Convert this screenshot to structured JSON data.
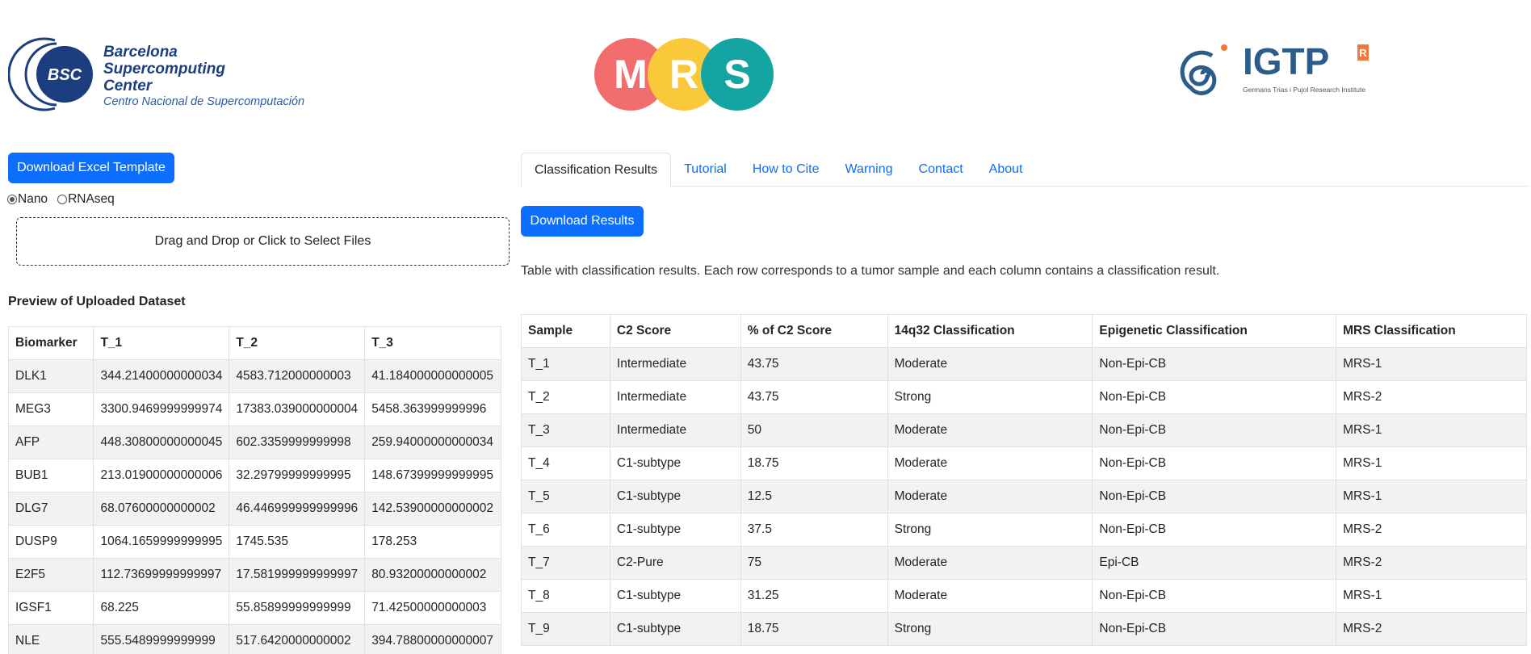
{
  "logos": {
    "bsc": {
      "mark": "BSC",
      "lines": [
        "Barcelona",
        "Supercomputing",
        "Center"
      ],
      "subtitle": "Centro Nacional de Supercomputación"
    },
    "mrs": {
      "letters": [
        "M",
        "R",
        "S"
      ],
      "colors": [
        "#f26e6e",
        "#f9c93b",
        "#14a5a3"
      ]
    },
    "igtp": {
      "name": "IGTP",
      "badge": "R",
      "subtitle": "Germans Trias i Pujol Research Institute"
    }
  },
  "left": {
    "template_button": "Download Excel Template",
    "radios": [
      {
        "label": "Nano",
        "checked": true
      },
      {
        "label": "RNAseq",
        "checked": false
      }
    ],
    "dropzone": "Drag and Drop or Click to Select Files",
    "preview_title": "Preview of Uploaded Dataset",
    "preview": {
      "headers": [
        "Biomarker",
        "T_1",
        "T_2",
        "T_3"
      ],
      "rows": [
        [
          "DLK1",
          "344.21400000000034",
          "4583.712000000003",
          "41.184000000000005"
        ],
        [
          "MEG3",
          "3300.9469999999974",
          "17383.039000000004",
          "5458.363999999996"
        ],
        [
          "AFP",
          "448.30800000000045",
          "602.3359999999998",
          "259.94000000000034"
        ],
        [
          "BUB1",
          "213.01900000000006",
          "32.29799999999995",
          "148.67399999999995"
        ],
        [
          "DLG7",
          "68.07600000000002",
          "46.446999999999996",
          "142.53900000000002"
        ],
        [
          "DUSP9",
          "1064.1659999999995",
          "1745.535",
          "178.253"
        ],
        [
          "E2F5",
          "112.73699999999997",
          "17.581999999999997",
          "80.93200000000002"
        ],
        [
          "IGSF1",
          "68.225",
          "55.85899999999999",
          "71.42500000000003"
        ],
        [
          "NLE",
          "555.5489999999999",
          "517.6420000000002",
          "394.78800000000007"
        ]
      ]
    }
  },
  "right": {
    "tabs": [
      "Classification Results",
      "Tutorial",
      "How to Cite",
      "Warning",
      "Contact",
      "About"
    ],
    "results_button": "Download Results",
    "description": "Table with classification results. Each row corresponds to a tumor sample and each column contains a classification result.",
    "results": {
      "headers": [
        "Sample",
        "C2 Score",
        "% of C2 Score",
        "14q32 Classification",
        "Epigenetic Classification",
        "MRS Classification"
      ],
      "rows": [
        [
          "T_1",
          "Intermediate",
          "43.75",
          "Moderate",
          "Non-Epi-CB",
          "MRS-1"
        ],
        [
          "T_2",
          "Intermediate",
          "43.75",
          "Strong",
          "Non-Epi-CB",
          "MRS-2"
        ],
        [
          "T_3",
          "Intermediate",
          "50",
          "Moderate",
          "Non-Epi-CB",
          "MRS-1"
        ],
        [
          "T_4",
          "C1-subtype",
          "18.75",
          "Moderate",
          "Non-Epi-CB",
          "MRS-1"
        ],
        [
          "T_5",
          "C1-subtype",
          "12.5",
          "Moderate",
          "Non-Epi-CB",
          "MRS-1"
        ],
        [
          "T_6",
          "C1-subtype",
          "37.5",
          "Strong",
          "Non-Epi-CB",
          "MRS-2"
        ],
        [
          "T_7",
          "C2-Pure",
          "75",
          "Moderate",
          "Epi-CB",
          "MRS-2"
        ],
        [
          "T_8",
          "C1-subtype",
          "31.25",
          "Moderate",
          "Non-Epi-CB",
          "MRS-1"
        ],
        [
          "T_9",
          "C1-subtype",
          "18.75",
          "Strong",
          "Non-Epi-CB",
          "MRS-2"
        ]
      ]
    }
  }
}
